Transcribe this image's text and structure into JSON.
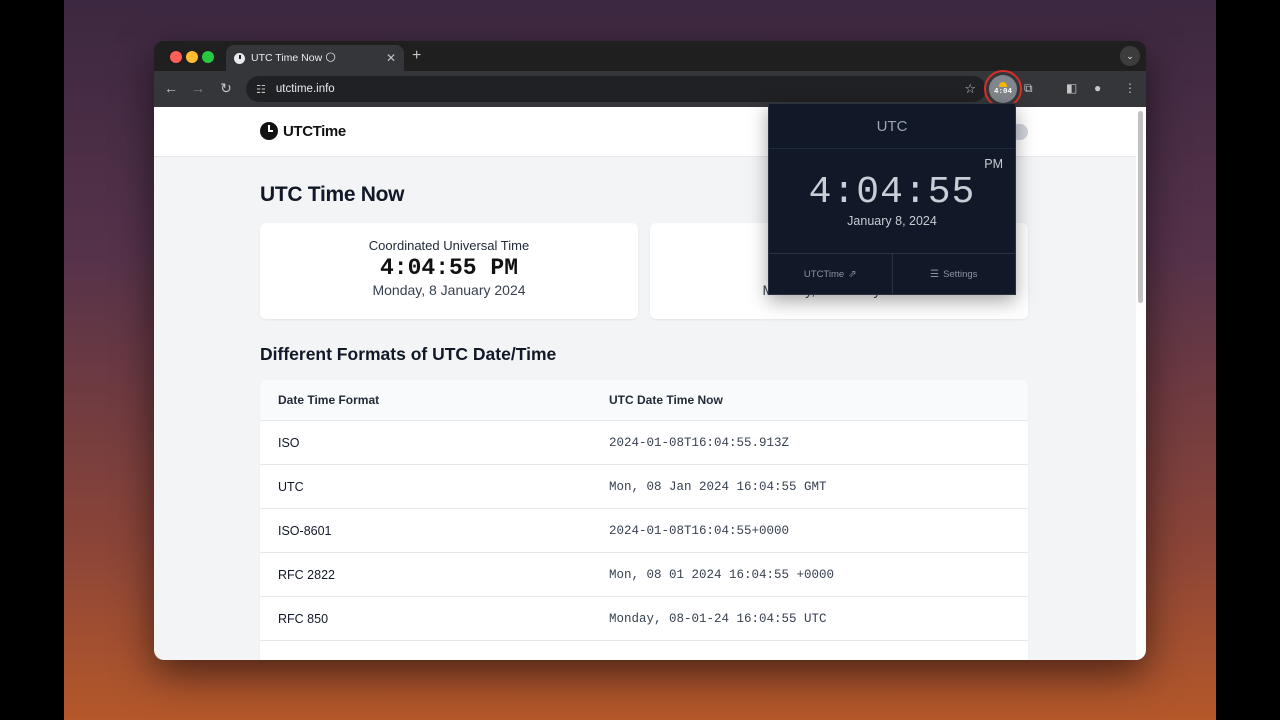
{
  "browser": {
    "tab_title": "UTC Time Now 🌕",
    "tab_close": "✕",
    "new_tab": "+",
    "tab_menu": "⌄",
    "url": "utctime.info",
    "icons": [
      "back-icon",
      "forward-icon",
      "reload-icon",
      "tune-icon",
      "star-icon",
      "extensions-icon",
      "side-panel-icon",
      "profile-icon",
      "menu-icon"
    ]
  },
  "extension": {
    "badge_time": "4:04"
  },
  "site": {
    "logo_text": "UTCTime",
    "page_title": "UTC Time Now",
    "card1": {
      "title": "Coordinated Universal Time",
      "time": "4:04:55 PM",
      "date": "Monday, 8 January 2024"
    },
    "card2": {
      "date": "Monday, 8 January 2024"
    },
    "section_title": "Different Formats of UTC Date/Time",
    "table": {
      "headers": [
        "Date Time Format",
        "UTC Date Time Now"
      ],
      "rows": [
        {
          "format": "ISO",
          "value": "2024-01-08T16:04:55.913Z"
        },
        {
          "format": "UTC",
          "value": "Mon, 08 Jan 2024 16:04:55 GMT"
        },
        {
          "format": "ISO-8601",
          "value": "2024-01-08T16:04:55+0000"
        },
        {
          "format": "RFC 2822",
          "value": "Mon, 08 01 2024 16:04:55 +0000"
        },
        {
          "format": "RFC 850",
          "value": "Monday, 08-01-24 16:04:55 UTC"
        }
      ]
    }
  },
  "popup": {
    "timezone": "UTC",
    "ampm": "PM",
    "time": "4:04:55",
    "date": "January 8, 2024",
    "link_label": "UTCTime",
    "settings_label": "Settings"
  }
}
